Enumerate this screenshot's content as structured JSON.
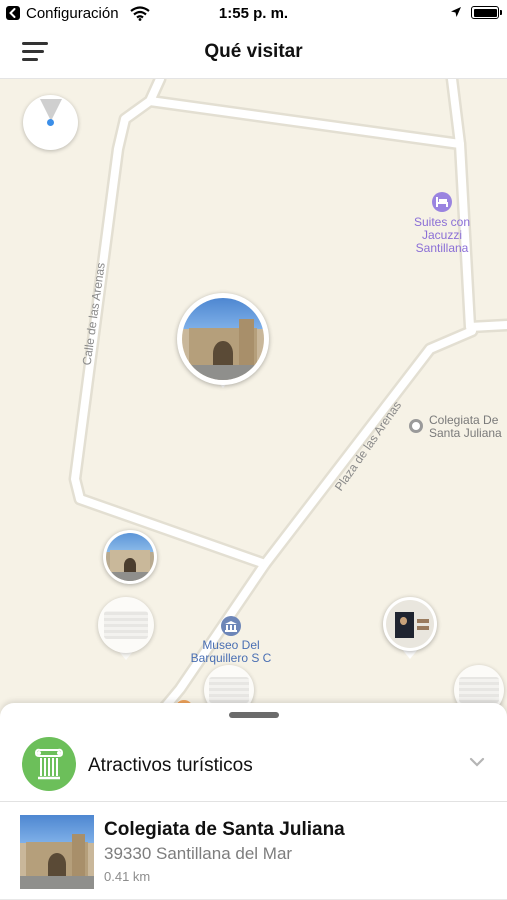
{
  "status_bar": {
    "carrier": "Configuración",
    "time": "1:55 p. m."
  },
  "header": {
    "title": "Qué visitar"
  },
  "map": {
    "streets": [
      "Calle de las Arenas",
      "Plaza de las Arenas"
    ],
    "pois": {
      "hotel": [
        "Suites con",
        "Jacuzzi",
        "Santillana"
      ],
      "museum": [
        "Museo Del",
        "Barquillero S C"
      ],
      "church": [
        "Colegiata De",
        "Santa Juliana"
      ]
    }
  },
  "sheet": {
    "category_label": "Atractivos turísticos",
    "place": {
      "name": "Colegiata de Santa Juliana",
      "address": "39330 Santillana del Mar",
      "distance": "0.41 km"
    }
  },
  "colors": {
    "map_background": "#f6f2e6",
    "category_green": "#6cbf5a",
    "hotel_poi": "#8b6fd6",
    "museum_poi": "#4a6fb3",
    "location_dot": "#3b8ee8"
  }
}
